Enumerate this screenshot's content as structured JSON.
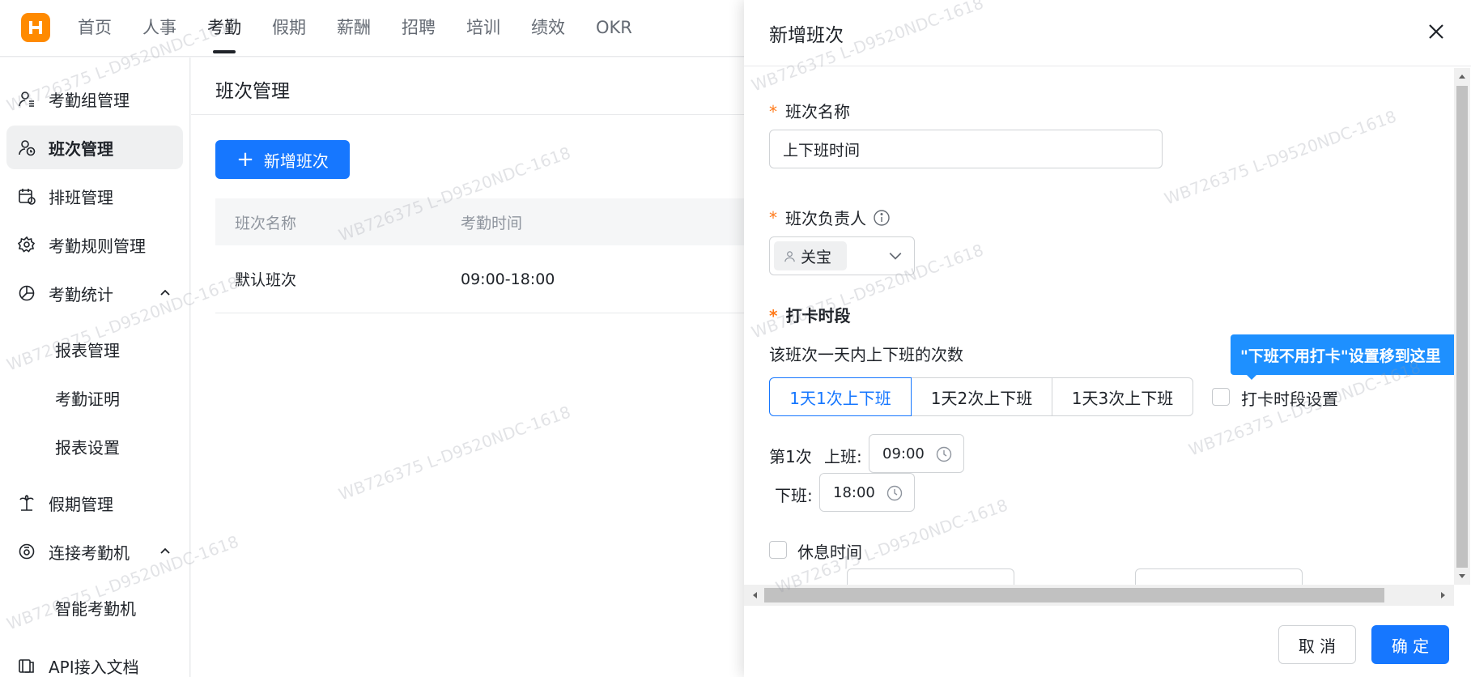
{
  "nav": {
    "items": [
      "首页",
      "人事",
      "考勤",
      "假期",
      "薪酬",
      "招聘",
      "培训",
      "绩效",
      "OKR"
    ],
    "active_index": 2
  },
  "sidebar": {
    "items": [
      {
        "label": "考勤组管理",
        "icon": "person-group-icon"
      },
      {
        "label": "班次管理",
        "icon": "person-clock-icon",
        "active": true
      },
      {
        "label": "排班管理",
        "icon": "calendar-icon"
      },
      {
        "label": "考勤规则管理",
        "icon": "gear-icon"
      },
      {
        "label": "考勤统计",
        "icon": "pie-chart-icon",
        "expanded": true
      },
      {
        "label": "假期管理",
        "icon": "palm-tree-icon"
      },
      {
        "label": "连接考勤机",
        "icon": "device-icon",
        "expanded": true
      },
      {
        "label": "API接入文档",
        "icon": "book-icon"
      }
    ],
    "sub_stats": [
      "报表管理",
      "考勤证明",
      "报表设置"
    ],
    "sub_device": [
      "智能考勤机"
    ]
  },
  "main": {
    "title": "班次管理",
    "add_button": "新增班次",
    "table": {
      "headers": [
        "班次名称",
        "考勤时间"
      ],
      "rows": [
        [
          "默认班次",
          "09:00-18:00"
        ]
      ]
    }
  },
  "drawer": {
    "title": "新增班次",
    "name_label": "班次名称",
    "name_value": "上下班时间",
    "owner_label": "班次负责人",
    "owner_tag": "关宝",
    "punch_label": "打卡时段",
    "punch_desc": "该班次一天内上下班的次数",
    "segments": [
      "1天1次上下班",
      "1天2次上下班",
      "1天3次上下班"
    ],
    "segment_active": 0,
    "punch_setting_label": "打卡时段设置",
    "tooltip": "\"下班不用打卡\"设置移到这里",
    "shift_index_label": "第1次",
    "on_label": "上班:",
    "on_time": "09:00",
    "off_label": "下班:",
    "off_time": "18:00",
    "rest_label": "休息时间",
    "cancel": "取 消",
    "confirm": "确 定"
  },
  "watermark": "WB726375 L-D9520NDC-1618",
  "colors": {
    "primary": "#1677ff",
    "logo": "#ff8a00",
    "required": "#ff7a1a"
  }
}
